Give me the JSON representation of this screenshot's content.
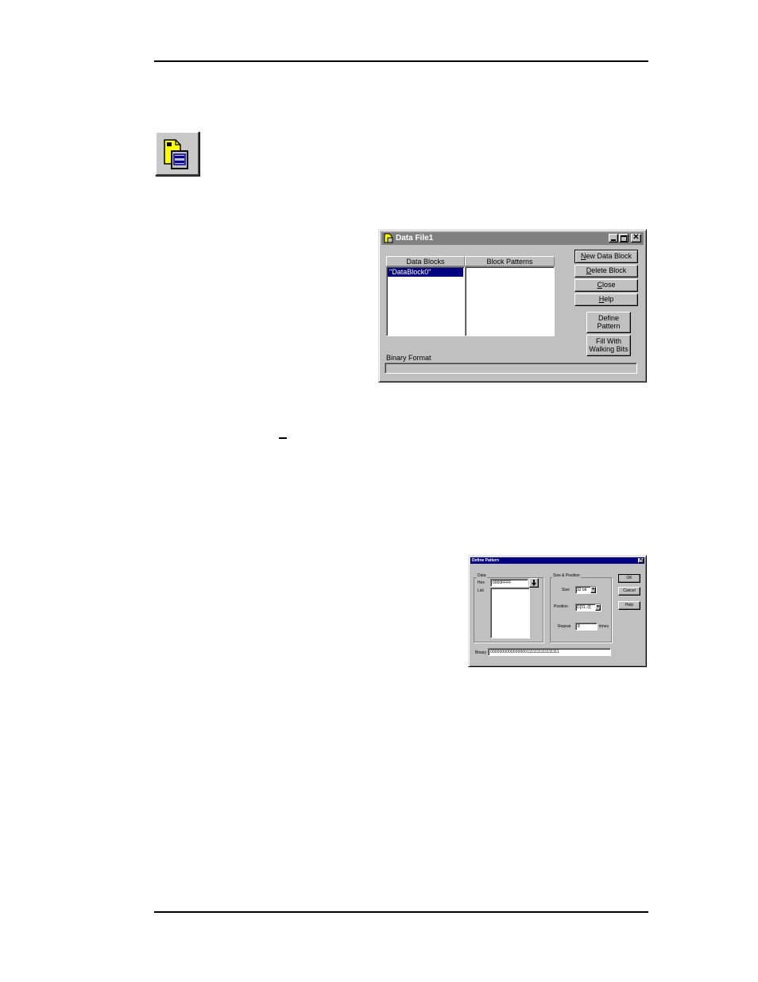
{
  "data_file_dialog": {
    "title": "Data File1",
    "headers": {
      "data_blocks": "Data Blocks",
      "block_patterns": "Block Patterns"
    },
    "data_blocks": [
      "\"DataBlock0\""
    ],
    "buttons": {
      "new_data_block": {
        "mnemonic": "N",
        "rest": "ew Data Block"
      },
      "delete_block": {
        "mnemonic": "D",
        "rest": "elete Block"
      },
      "close": {
        "mnemonic": "C",
        "rest": "lose"
      },
      "help": {
        "mnemonic": "H",
        "rest": "elp"
      },
      "define_pattern": [
        "Define",
        "Pattern"
      ],
      "fill_walking_bits": [
        "Fill With",
        "Walking Bits"
      ]
    },
    "binary_format_label": "Binary Format",
    "binary_format_value": ""
  },
  "define_pattern_dialog": {
    "title": "Define Pattern",
    "data_group": "Data",
    "hex_label": "Hex",
    "hex_value": "0000FFFF",
    "list_label": "List",
    "size_position_group": "Size & Position",
    "size_label": "Size",
    "size_value": "32 bit",
    "position_label": "Position",
    "position_value": "D[31..0]",
    "repeat_label": "Repeat",
    "repeat_value": "8",
    "repeat_unit": "times",
    "binary_label": "Binary",
    "binary_value": "00000000000000001111111111111111",
    "buttons": {
      "ok": "OK",
      "cancel": "Cancel",
      "help": "Help"
    }
  },
  "colors": {
    "dialog_face": "#c0c0c0",
    "inactive_title": "#808080",
    "active_title": "#000080",
    "selection": "#000080"
  },
  "icons": {
    "toolbar_button": "data-file-icon",
    "title_icon": "data-file-icon",
    "dropdown": "arrow-down-icon"
  }
}
